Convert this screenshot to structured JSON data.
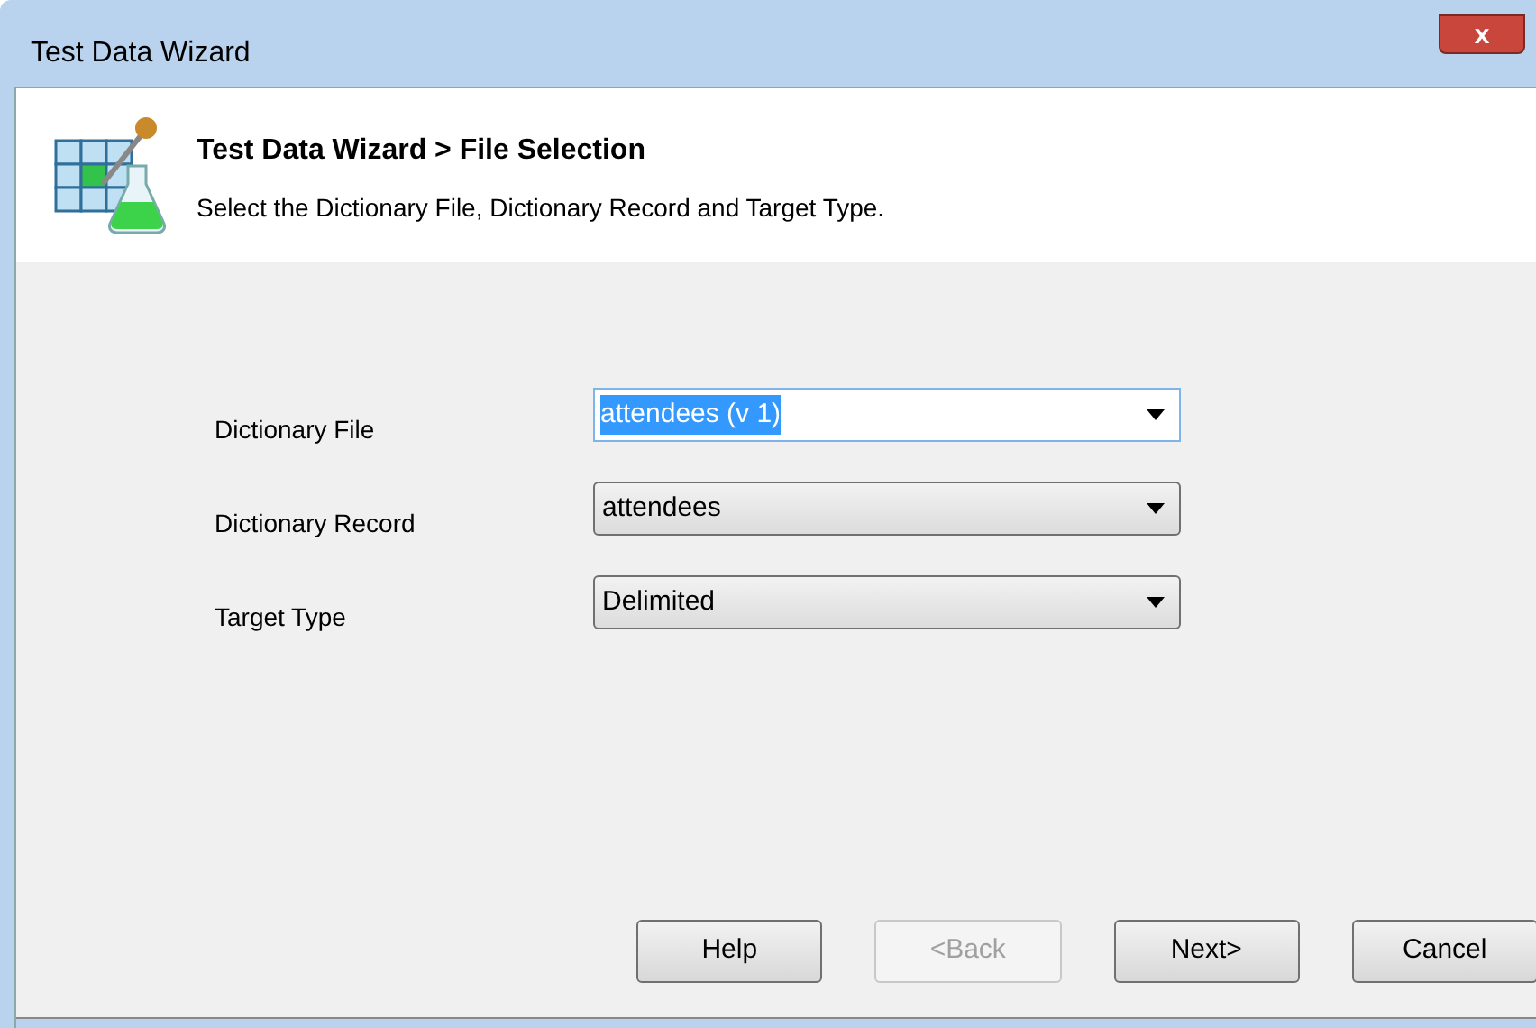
{
  "window": {
    "title": "Test Data Wizard",
    "close_label": "x"
  },
  "header": {
    "title": "Test Data Wizard > File Selection",
    "subtitle": "Select the Dictionary File, Dictionary Record and Target Type."
  },
  "fields": [
    {
      "label": "Dictionary File",
      "kind": "editable",
      "value": "attendees (v 1)",
      "text_selected": true
    },
    {
      "label": "Dictionary Record",
      "kind": "dropdown",
      "value": "attendees"
    },
    {
      "label": "Target Type",
      "kind": "dropdown",
      "value": "Delimited"
    }
  ],
  "buttons": [
    {
      "label": "Help",
      "disabled": false
    },
    {
      "label": "<Back",
      "disabled": true
    },
    {
      "label": "Next>",
      "disabled": false
    },
    {
      "label": "Cancel",
      "disabled": false
    }
  ]
}
